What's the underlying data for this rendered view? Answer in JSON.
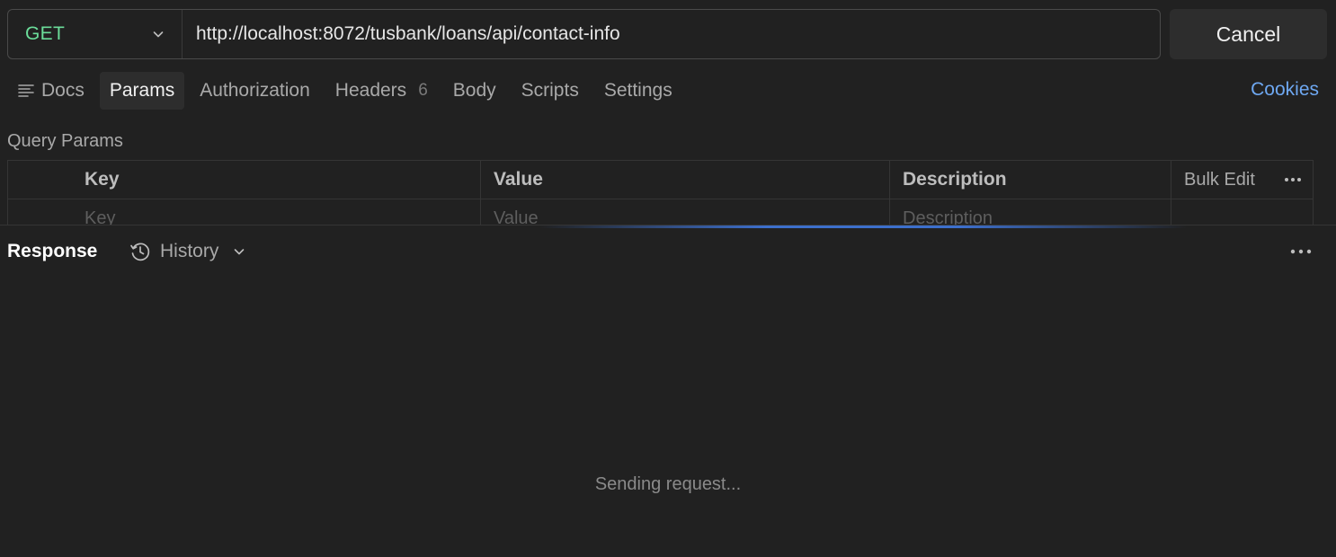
{
  "request": {
    "method": "GET",
    "url": "http://localhost:8072/tusbank/loans/api/contact-info",
    "cancel_label": "Cancel"
  },
  "tabs": [
    {
      "label": "Docs",
      "icon": "docs-lines-icon"
    },
    {
      "label": "Params",
      "active": true
    },
    {
      "label": "Authorization"
    },
    {
      "label": "Headers",
      "count": "6"
    },
    {
      "label": "Body"
    },
    {
      "label": "Scripts"
    },
    {
      "label": "Settings"
    }
  ],
  "cookies_label": "Cookies",
  "query_params": {
    "title": "Query Params",
    "columns": {
      "key": "Key",
      "value": "Value",
      "description": "Description"
    },
    "bulk_edit_label": "Bulk Edit",
    "placeholders": {
      "key": "Key",
      "value": "Value",
      "description": "Description"
    }
  },
  "response": {
    "title": "Response",
    "history_label": "History",
    "status_text": "Sending request..."
  },
  "colors": {
    "method_get": "#6bdd9a",
    "link": "#6ea8f2",
    "background": "#212121",
    "progress": "#3d6fcc"
  }
}
